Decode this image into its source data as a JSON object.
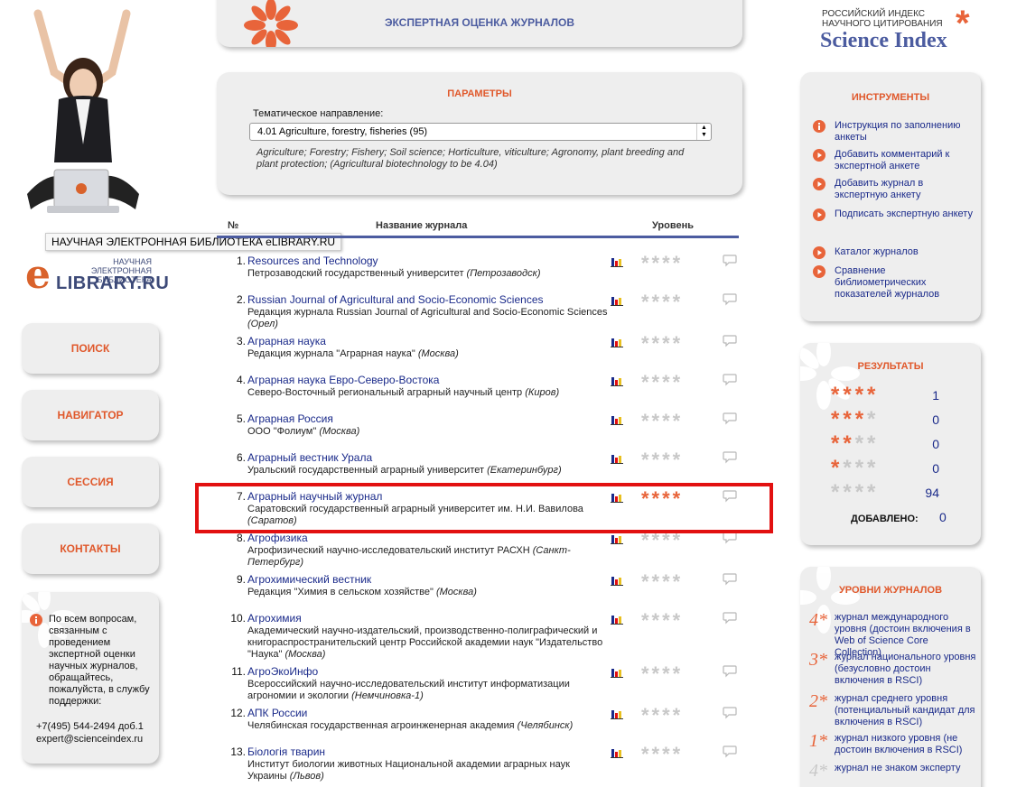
{
  "header": {
    "title": "ЭКСПЕРТНАЯ ОЦЕНКА ЖУРНАЛОВ"
  },
  "elibrary": {
    "caption": "НАУЧНАЯ ЭЛЕКТРОННАЯ БИБЛИОТЕКА eLIBRARY.RU",
    "logo_small": "НАУЧНАЯ ЭЛЕКТРОННАЯ БИБЛИОТЕКА",
    "logo_big": "LIBRARY.RU",
    "logo_e": "e"
  },
  "nav": {
    "search": "ПОИСК",
    "navigator": "НАВИГАТОР",
    "session": "СЕССИЯ",
    "contacts": "КОНТАКТЫ"
  },
  "help": {
    "text": "По всем вопросам, связанным с проведением экспертной оценки научных журналов, обращайтесь, пожалуйста, в службу поддержки:",
    "phone": "+7(495) 544-2494 доб.1",
    "email": "expert@scienceindex.ru"
  },
  "params": {
    "title": "ПАРАМЕТРЫ",
    "label": "Тематическое направление:",
    "selected": "4.01 Agriculture, forestry, fisheries (95)",
    "description": "Agriculture; Forestry; Fishery; Soil science; Horticulture, viticulture; Agronomy, plant breeding and plant protection; (Agricultural biotechnology to be 4.04)"
  },
  "table": {
    "col_num": "№",
    "col_name": "Название журнала",
    "col_level": "Уровень",
    "rows": [
      {
        "num": "1.",
        "name": "Resources and Technology",
        "org": "Петрозаводский государственный университет",
        "city": "(Петрозаводск)",
        "stars": 0
      },
      {
        "num": "2.",
        "name": "Russian Journal of Agricultural and Socio-Economic Sciences",
        "org": "Редакция журнала Russian Journal of Agricultural and Socio-Economic Sciences",
        "city": "(Орел)",
        "stars": 0
      },
      {
        "num": "3.",
        "name": "Аграрная наука",
        "org": "Редакция журнала \"Аграрная наука\"",
        "city": "(Москва)",
        "stars": 0
      },
      {
        "num": "4.",
        "name": "Аграрная наука Евро-Северо-Востока",
        "org": "Северо-Восточный региональный аграрный научный центр",
        "city": "(Киров)",
        "stars": 0
      },
      {
        "num": "5.",
        "name": "Аграрная Россия",
        "org": "ООО \"Фолиум\"",
        "city": "(Москва)",
        "stars": 0
      },
      {
        "num": "6.",
        "name": "Аграрный вестник Урала",
        "org": "Уральский государственный аграрный университет",
        "city": "(Екатеринбург)",
        "stars": 0
      },
      {
        "num": "7.",
        "name": "Аграрный научный журнал",
        "org": "Саратовский государственный аграрный университет им. Н.И. Вавилова",
        "city": "(Саратов)",
        "stars": 4
      },
      {
        "num": "8.",
        "name": "Агрофизика",
        "org": "Агрофизический научно-исследовательский институт РАСХН",
        "city": "(Санкт-Петербург)",
        "stars": 0
      },
      {
        "num": "9.",
        "name": "Агрохимический вестник",
        "org": "Редакция \"Химия в сельском хозяйстве\"",
        "city": "(Москва)",
        "stars": 0
      },
      {
        "num": "10.",
        "name": "Агрохимия",
        "org": "Академический научно-издательский, производственно-полиграфический и книгораспространительский центр Российской академии наук \"Издательство \"Наука\"",
        "city": "(Москва)",
        "stars": 0
      },
      {
        "num": "11.",
        "name": "АгроЭкоИнфо",
        "org": "Всероссийский научно-исследовательский институт информатизации агрономии и экологии",
        "city": "(Немчиновка-1)",
        "stars": 0
      },
      {
        "num": "12.",
        "name": "АПК России",
        "org": "Челябинская государственная агроинженерная академия",
        "city": "(Челябинск)",
        "stars": 0
      },
      {
        "num": "13.",
        "name": "Біологія тварин",
        "org": "Институт биологии животных Национальной академии аграрных наук Украины",
        "city": "(Львов)",
        "stars": 0
      }
    ]
  },
  "scienceindex": {
    "line1": "РОССИЙСКИЙ ИНДЕКС",
    "line2": "НАУЧНОГО ЦИТИРОВАНИЯ",
    "brand": "Science Index"
  },
  "tools": {
    "title": "ИНСТРУМЕНТЫ",
    "items": [
      {
        "label": "Инструкция по заполнению анкеты",
        "icon": "info-icon"
      },
      {
        "label": "Добавить комментарий к экспертной анкете",
        "icon": "play-icon"
      },
      {
        "label": "Добавить журнал в экспертную анкету",
        "icon": "play-icon"
      },
      {
        "label": "Подписать экспертную анкету",
        "icon": "play-icon"
      },
      {
        "label": "Каталог журналов",
        "icon": "play-icon"
      },
      {
        "label": "Сравнение библиометрических показателей журналов",
        "icon": "play-icon"
      }
    ]
  },
  "results": {
    "title": "РЕЗУЛЬТАТЫ",
    "rows": [
      {
        "stars": 4,
        "count": "1"
      },
      {
        "stars": 3,
        "count": "0"
      },
      {
        "stars": 2,
        "count": "0"
      },
      {
        "stars": 1,
        "count": "0"
      },
      {
        "stars": 0,
        "count": "94"
      }
    ],
    "added_label": "ДОБАВЛЕНО:",
    "added_count": "0"
  },
  "levels": {
    "title": "УРОВНИ ЖУРНАЛОВ",
    "items": [
      {
        "mark": "4*",
        "text": "журнал международного уровня (достоин включения в Web of Science Core Collection)"
      },
      {
        "mark": "3*",
        "text": "журнал национального уровня (безусловно достоин включения в RSCI)"
      },
      {
        "mark": "2*",
        "text": "журнал среднего уровня (потенциальный кандидат для включения в RSCI)"
      },
      {
        "mark": "1*",
        "text": "журнал низкого уровня (не достоин включения в RSCI)"
      },
      {
        "mark": "4*",
        "text": "журнал не знаком эксперту"
      }
    ]
  },
  "colors": {
    "accent": "#e8643a",
    "brand": "#4c5ca0",
    "link": "#1a2a8a",
    "highlight": "#e21010"
  }
}
